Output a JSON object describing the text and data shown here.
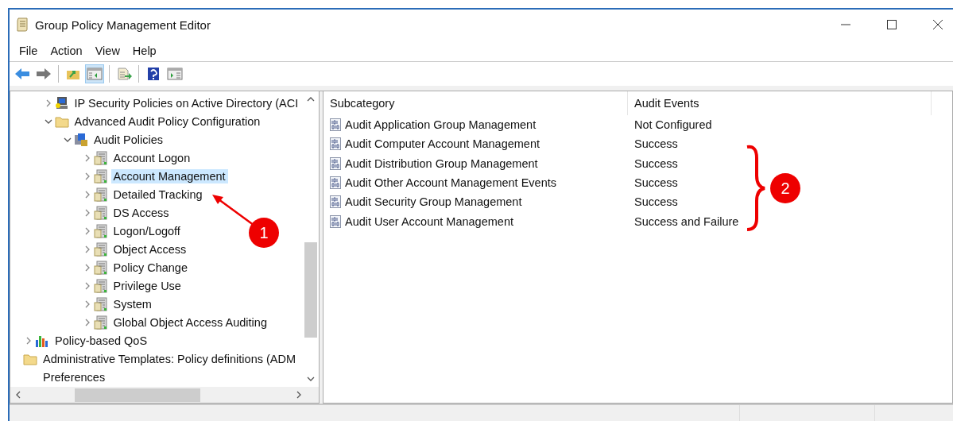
{
  "window": {
    "title": "Group Policy Management Editor"
  },
  "menu": [
    "File",
    "Action",
    "View",
    "Help"
  ],
  "toolbar": [
    {
      "kind": "back",
      "selected": false
    },
    {
      "kind": "forward",
      "selected": false
    },
    {
      "kind": "separator"
    },
    {
      "kind": "up-folder",
      "selected": false
    },
    {
      "kind": "tree-pane",
      "selected": true
    },
    {
      "kind": "separator"
    },
    {
      "kind": "export",
      "selected": false
    },
    {
      "kind": "separator"
    },
    {
      "kind": "help",
      "selected": false
    },
    {
      "kind": "action-pane",
      "selected": false
    }
  ],
  "tree": [
    {
      "children": [
        {
          "children": [
            {
              "children": [
                {
                  "label": "IP Security Policies on Active Directory (ACI",
                  "kind": "computer-lock",
                  "expanded": false,
                  "selected": false
                },
                {
                  "label": "Advanced Audit Policy Configuration",
                  "kind": "folder",
                  "expanded": true,
                  "selected": false,
                  "children": [
                    {
                      "label": "Audit Policies",
                      "kind": "audit-policies",
                      "expanded": true,
                      "selected": false,
                      "children": [
                        {
                          "label": "Account Logon",
                          "kind": "category",
                          "expanded": false,
                          "selected": false
                        },
                        {
                          "label": "Account Management",
                          "kind": "category",
                          "expanded": false,
                          "selected": true
                        },
                        {
                          "label": "Detailed Tracking",
                          "kind": "category",
                          "expanded": false,
                          "selected": false
                        },
                        {
                          "label": "DS Access",
                          "kind": "category",
                          "expanded": false,
                          "selected": false
                        },
                        {
                          "label": "Logon/Logoff",
                          "kind": "category",
                          "expanded": false,
                          "selected": false
                        },
                        {
                          "label": "Object Access",
                          "kind": "category",
                          "expanded": false,
                          "selected": false
                        },
                        {
                          "label": "Policy Change",
                          "kind": "category",
                          "expanded": false,
                          "selected": false
                        },
                        {
                          "label": "Privilege Use",
                          "kind": "category",
                          "expanded": false,
                          "selected": false
                        },
                        {
                          "label": "System",
                          "kind": "category",
                          "expanded": false,
                          "selected": false
                        },
                        {
                          "label": "Global Object Access Auditing",
                          "kind": "category",
                          "expanded": false,
                          "selected": false
                        }
                      ]
                    }
                  ]
                }
              ]
            },
            {
              "label": "Policy-based QoS",
              "kind": "chart",
              "expanded": false,
              "selected": false
            }
          ]
        },
        {
          "label": "Administrative Templates: Policy definitions (ADM",
          "kind": "folder",
          "selected": false
        }
      ]
    },
    {
      "label": "Preferences",
      "selected": false
    }
  ],
  "list": {
    "columns": [
      "Subcategory",
      "Audit Events"
    ],
    "rows": [
      {
        "subcategory": "Audit Application Group Management",
        "audit_events": "Not Configured"
      },
      {
        "subcategory": "Audit Computer Account Management",
        "audit_events": "Success"
      },
      {
        "subcategory": "Audit Distribution Group Management",
        "audit_events": "Success"
      },
      {
        "subcategory": "Audit Other Account Management Events",
        "audit_events": "Success"
      },
      {
        "subcategory": "Audit Security Group Management",
        "audit_events": "Success"
      },
      {
        "subcategory": "Audit User Account Management",
        "audit_events": "Success and Failure"
      }
    ]
  },
  "annotations": [
    {
      "kind": "arrow",
      "label": "1"
    },
    {
      "kind": "brace",
      "label": "2"
    }
  ]
}
